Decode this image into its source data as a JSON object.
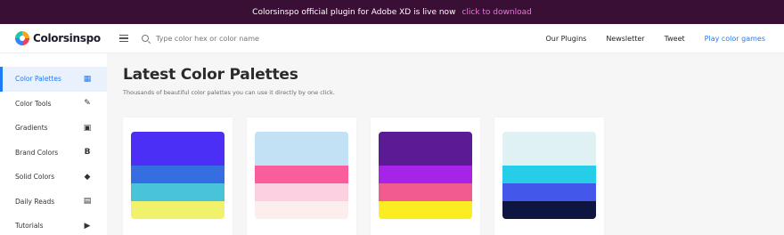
{
  "banner": {
    "text": "Colorsinspo official plugin for Adobe XD is live now",
    "link": "click to download"
  },
  "header": {
    "logo": "Colorsinspo",
    "search_placeholder": "Type color hex or color name",
    "nav": [
      "Our Plugins",
      "Newsletter",
      "Tweet",
      "Play color games"
    ]
  },
  "sidebar": {
    "items": [
      {
        "label": "Color Palettes",
        "icon": "grid-icon",
        "glyph": "▦"
      },
      {
        "label": "Color Tools",
        "icon": "pen-icon",
        "glyph": "✎"
      },
      {
        "label": "Gradients",
        "icon": "image-icon",
        "glyph": "▣"
      },
      {
        "label": "Brand Colors",
        "icon": "bold-b-icon",
        "glyph": "B"
      },
      {
        "label": "Solid Colors",
        "icon": "paint-bucket-icon",
        "glyph": "◆"
      },
      {
        "label": "Daily Reads",
        "icon": "article-icon",
        "glyph": "▤"
      },
      {
        "label": "Tutorials",
        "icon": "play-video-icon",
        "glyph": "▶"
      }
    ]
  },
  "main": {
    "title": "Latest Color Palettes",
    "subtitle": "Thousands of beautiful color palettes you can use it directly by one click."
  },
  "palettes": [
    [
      "#4b2ff5",
      "#356ee0",
      "#48c3da",
      "#f1f26b"
    ],
    [
      "#c3e1f4",
      "#f95d9b",
      "#fccfe1",
      "#fdeeee"
    ],
    [
      "#5a1b95",
      "#a524e8",
      "#f15b90",
      "#faee22"
    ],
    [
      "#e0f1f3",
      "#25cde8",
      "#4357ea",
      "#0d1540"
    ]
  ]
}
